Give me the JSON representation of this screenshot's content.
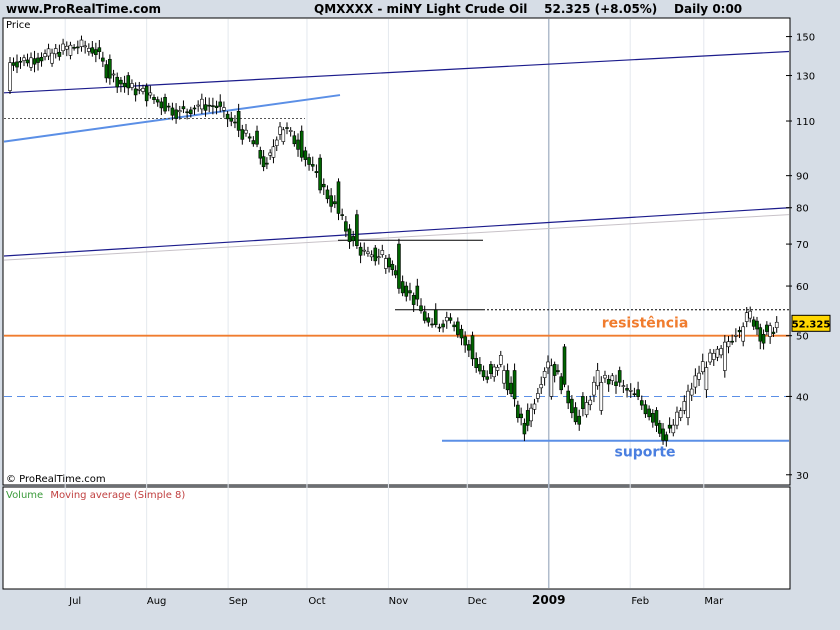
{
  "header": {
    "site": "www.ProRealTime.com",
    "symbol": "QMXXXX - miNY Light Crude Oil",
    "last_price": "52.325",
    "change": "(+8.05%)",
    "period": "Daily",
    "time": "0:00"
  },
  "price_panel": {
    "label": "Price",
    "copyright": "© ProRealTime.com"
  },
  "volume_panel": {
    "label_volume": "Volume",
    "label_ma": "Moving average (Simple 8)"
  },
  "colors": {
    "background": "#ffffff",
    "frame": "#d6dde6",
    "up_candle": "#ffffff",
    "down_candle": "#006400",
    "blue_line": "#5b8fe6",
    "navy_line": "#1c1c8c",
    "orange_line": "#f07c2e",
    "annotation_orange": "#f07c2e",
    "annotation_blue": "#4a7fe0",
    "price_tag": "#ffd700",
    "volume_label": "#3a9a3a",
    "ma_label": "#c04040"
  },
  "chart_data": {
    "type": "candlestick",
    "y_scale": "log",
    "ylim": [
      29,
      160
    ],
    "y_ticks": [
      30,
      40,
      50,
      60,
      70,
      80,
      90,
      110,
      130,
      150
    ],
    "x_months": [
      "Jul",
      "Aug",
      "Sep",
      "Oct",
      "Nov",
      "Dec",
      "2009",
      "Feb",
      "Mar"
    ],
    "last_price": 52.325,
    "x_start": "2008-06-10",
    "x_end": "2009-03-30",
    "series": [
      {
        "values": [
          [
            "2008-06-10",
            123,
            136
          ],
          [
            "2008-06-18",
            134,
            138
          ],
          [
            "2008-06-26",
            136,
            140
          ],
          [
            "2008-07-03",
            140,
            144
          ],
          [
            "2008-07-10",
            142,
            145
          ],
          [
            "2008-07-14",
            144,
            142
          ],
          [
            "2008-07-18",
            138,
            132
          ],
          [
            "2008-07-25",
            130,
            125
          ],
          [
            "2008-08-01",
            125,
            122
          ],
          [
            "2008-08-08",
            120,
            117
          ],
          [
            "2008-08-15",
            116,
            113
          ],
          [
            "2008-08-22",
            115,
            117
          ],
          [
            "2008-08-29",
            118,
            116
          ],
          [
            "2008-09-05",
            114,
            108
          ],
          [
            "2008-09-12",
            106,
            101
          ],
          [
            "2008-09-17",
            97,
            92
          ],
          [
            "2008-09-22",
            102,
            109
          ],
          [
            "2008-09-29",
            106,
            101
          ],
          [
            "2008-10-06",
            96,
            89
          ],
          [
            "2008-10-13",
            88,
            80
          ],
          [
            "2008-10-20",
            78,
            70
          ],
          [
            "2008-10-27",
            69,
            66
          ],
          [
            "2008-10-31",
            64,
            68
          ],
          [
            "2008-11-05",
            70,
            62
          ],
          [
            "2008-11-12",
            60,
            57
          ],
          [
            "2008-11-19",
            55,
            51
          ],
          [
            "2008-11-26",
            52,
            54
          ],
          [
            "2008-12-03",
            50,
            47
          ],
          [
            "2008-12-10",
            45,
            42
          ],
          [
            "2008-12-15",
            42,
            46
          ],
          [
            "2008-12-19",
            44,
            40
          ],
          [
            "2008-12-24",
            38,
            35
          ],
          [
            "2009-01-02",
            40,
            46
          ],
          [
            "2009-01-07",
            48,
            42
          ],
          [
            "2009-01-14",
            40,
            36
          ],
          [
            "2009-01-21",
            38,
            43
          ],
          [
            "2009-01-28",
            44,
            42
          ],
          [
            "2009-02-04",
            41,
            40
          ],
          [
            "2009-02-11",
            38,
            37
          ],
          [
            "2009-02-16",
            36,
            34
          ],
          [
            "2009-02-23",
            37,
            39
          ],
          [
            "2009-03-02",
            41,
            45
          ],
          [
            "2009-03-09",
            44,
            47
          ],
          [
            "2009-03-16",
            49,
            52
          ],
          [
            "2009-03-20",
            53,
            54
          ],
          [
            "2009-03-25",
            52,
            49
          ],
          [
            "2009-03-30",
            48,
            52.325
          ]
        ]
      }
    ],
    "annotations": [
      {
        "text": "resistência",
        "price": 50
      },
      {
        "text": "suporte",
        "price": 34
      }
    ]
  }
}
